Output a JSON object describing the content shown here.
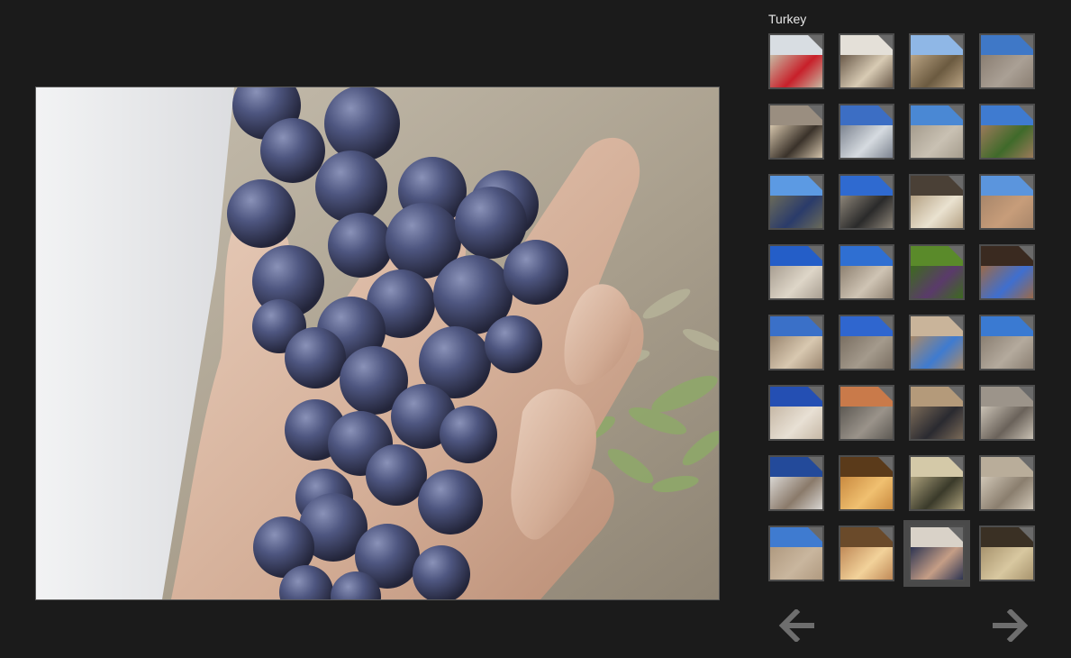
{
  "gallery": {
    "title": "Turkey",
    "selected_index": 30
  },
  "thumbnails": [
    {
      "sky": "#d8dde2",
      "ground": "#c7b9a3",
      "accent": "#c8202a"
    },
    {
      "sky": "#e4e0d8",
      "ground": "#6a5a4a",
      "accent": "#d8cbb4"
    },
    {
      "sky": "#8fb7e6",
      "ground": "#b9a383",
      "accent": "#6b5a40"
    },
    {
      "sky": "#3f78c7",
      "ground": "#8a7e72",
      "accent": "#aaa095"
    },
    {
      "sky": "#9a8e80",
      "ground": "#d3c3aa",
      "accent": "#3a322a"
    },
    {
      "sky": "#3c6ec4",
      "ground": "#7d8490",
      "accent": "#d6dbe0"
    },
    {
      "sky": "#4a88d4",
      "ground": "#a59c8d",
      "accent": "#c9c1b3"
    },
    {
      "sky": "#3f7bd0",
      "ground": "#9b7a5a",
      "accent": "#3f6a2a"
    },
    {
      "sky": "#5c9ae3",
      "ground": "#6a6a5a",
      "accent": "#2a3b6a"
    },
    {
      "sky": "#2f6ad0",
      "ground": "#8c8478",
      "accent": "#2a2a2a"
    },
    {
      "sky": "#4a4036",
      "ground": "#b4a184",
      "accent": "#eae2d0"
    },
    {
      "sky": "#5b95dd",
      "ground": "#a8866a",
      "accent": "#c79d7a"
    },
    {
      "sky": "#245ec8",
      "ground": "#a89e91",
      "accent": "#ded6c8"
    },
    {
      "sky": "#2f6fd2",
      "ground": "#8e8171",
      "accent": "#cfc4b4"
    },
    {
      "sky": "#5a8a2a",
      "ground": "#3d6a1f",
      "accent": "#5a3a6a"
    },
    {
      "sky": "#3a2a20",
      "ground": "#9a6a4a",
      "accent": "#3f6fcf"
    },
    {
      "sky": "#3a70c8",
      "ground": "#9a8670",
      "accent": "#d8c8b0"
    },
    {
      "sky": "#2f66cf",
      "ground": "#7a6f62",
      "accent": "#a49a8c"
    },
    {
      "sky": "#c9b49a",
      "ground": "#a88a6a",
      "accent": "#3f7bd0"
    },
    {
      "sky": "#3a7ad2",
      "ground": "#8a7f72",
      "accent": "#b4aa9d"
    },
    {
      "sky": "#244fb3",
      "ground": "#c6b8a6",
      "accent": "#e8e0d4"
    },
    {
      "sky": "#c97a4a",
      "ground": "#5e5a54",
      "accent": "#9a938a"
    },
    {
      "sky": "#b49a7a",
      "ground": "#7a6a58",
      "accent": "#2a2a30"
    },
    {
      "sky": "#9c948a",
      "ground": "#c9c1b4",
      "accent": "#6a625a"
    },
    {
      "sky": "#234a9a",
      "ground": "#d9d6d2",
      "accent": "#8a7a6a"
    },
    {
      "sky": "#5a3a1a",
      "ground": "#c98a40",
      "accent": "#f0c070"
    },
    {
      "sky": "#d4c9a8",
      "ground": "#a99e7a",
      "accent": "#3a3a2a"
    },
    {
      "sky": "#b9ad9a",
      "ground": "#d0c6b6",
      "accent": "#8a7e6e"
    },
    {
      "sky": "#3f7bd0",
      "ground": "#b09a80",
      "accent": "#c9b69e"
    },
    {
      "sky": "#6a4a2a",
      "ground": "#c08a58",
      "accent": "#f2d29a"
    },
    {
      "sky": "#d9d2c8",
      "ground": "#2e3552",
      "accent": "#c59e86"
    },
    {
      "sky": "#3a3024",
      "ground": "#a8946e",
      "accent": "#d8c8a0"
    }
  ],
  "icons": {
    "prev": "arrow-left-icon",
    "next": "arrow-right-icon"
  },
  "colors": {
    "background": "#1b1b1b",
    "thumb_border": "#4d4d4d",
    "arrow": "#6e6e6e"
  }
}
